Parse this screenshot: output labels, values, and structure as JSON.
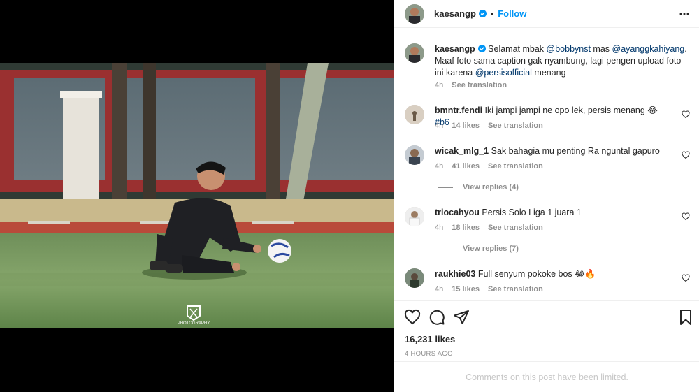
{
  "post": {
    "author": "kaesangp",
    "follow_label": "Follow",
    "separator": "•",
    "more_icon": "more-options-icon"
  },
  "photo": {
    "watermark": "PHOTOGRAPHY"
  },
  "caption": {
    "username": "kaesangp",
    "text_prefix": "Selamat mbak ",
    "mention1": "@bobbynst",
    "text_mid1": " mas ",
    "mention2": "@ayanggkahiyang",
    "text_mid2": ". Maaf foto sama caption gak nyambung, lagi pengen upload foto ini karena ",
    "mention3": "@persisofficial",
    "text_suffix": " menang",
    "time": "4h",
    "see_translation": "See translation"
  },
  "comments": [
    {
      "username": "bmntr.fendi",
      "text": "Iki jampi jampi ne opo lek, persis menang 😂 ",
      "hashtag": "#b6",
      "time": "4h",
      "likes": "14 likes",
      "see_translation": "See translation"
    },
    {
      "username": "wicak_mlg_1",
      "text": "Sak bahagia mu penting Ra nguntal gapuro",
      "time": "4h",
      "likes": "41 likes",
      "see_translation": "See translation",
      "replies": "View replies (4)"
    },
    {
      "username": "triocahyou",
      "text": "Persis Solo Liga 1 juara 1",
      "time": "4h",
      "likes": "18 likes",
      "see_translation": "See translation",
      "replies": "View replies (7)"
    },
    {
      "username": "raukhie03",
      "text": "Full senyum pokoke bos 😂🔥",
      "time": "4h",
      "likes": "15 likes",
      "see_translation": "See translation"
    }
  ],
  "likes": "16,231 likes",
  "posted": "4 HOURS AGO",
  "limited_notice": "Comments on this post have been limited.",
  "colors": {
    "accent": "#0095f6",
    "text": "#262626",
    "muted": "#8e8e8e",
    "mention": "#00376b"
  }
}
